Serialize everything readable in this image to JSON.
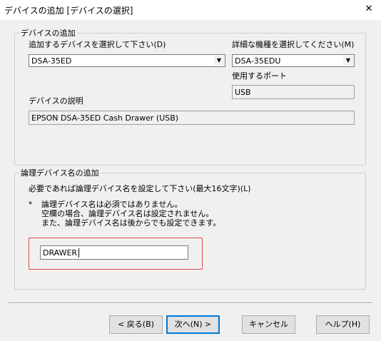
{
  "window": {
    "title": "デバイスの追加 [デバイスの選択]",
    "close_glyph": "✕"
  },
  "device_group": {
    "legend": "デバイスの追加",
    "device_select_label": "追加するデバイスを選択して下さい(D)",
    "device_value": "DSA-35ED",
    "model_select_label": "詳細な機種を選択してください(M)",
    "model_value": "DSA-35EDU",
    "port_label": "使用するポート",
    "port_value": "USB",
    "description_label": "デバイスの説明",
    "description_value": "EPSON DSA-35ED Cash Drawer (USB)",
    "dropdown_arrow": "▼"
  },
  "logical_group": {
    "legend": "論理デバイス名の追加",
    "instruction": "必要であれば論理デバイス名を設定して下さい(最大16文字)(L)",
    "note_bullet": "*",
    "note_line1": "論理デバイス名は必須ではありません。",
    "note_line2": "空欄の場合、論理デバイス名は設定されません。",
    "note_line3": "また、論理デバイス名は後からでも設定できます。",
    "name_value": "DRAWER"
  },
  "buttons": {
    "back": "< 戻る(B)",
    "next": "次へ(N) >",
    "cancel": "キャンセル",
    "help": "ヘルプ(H)"
  },
  "colors": {
    "highlight": "#e04848",
    "default_button_border": "#0078d7"
  }
}
